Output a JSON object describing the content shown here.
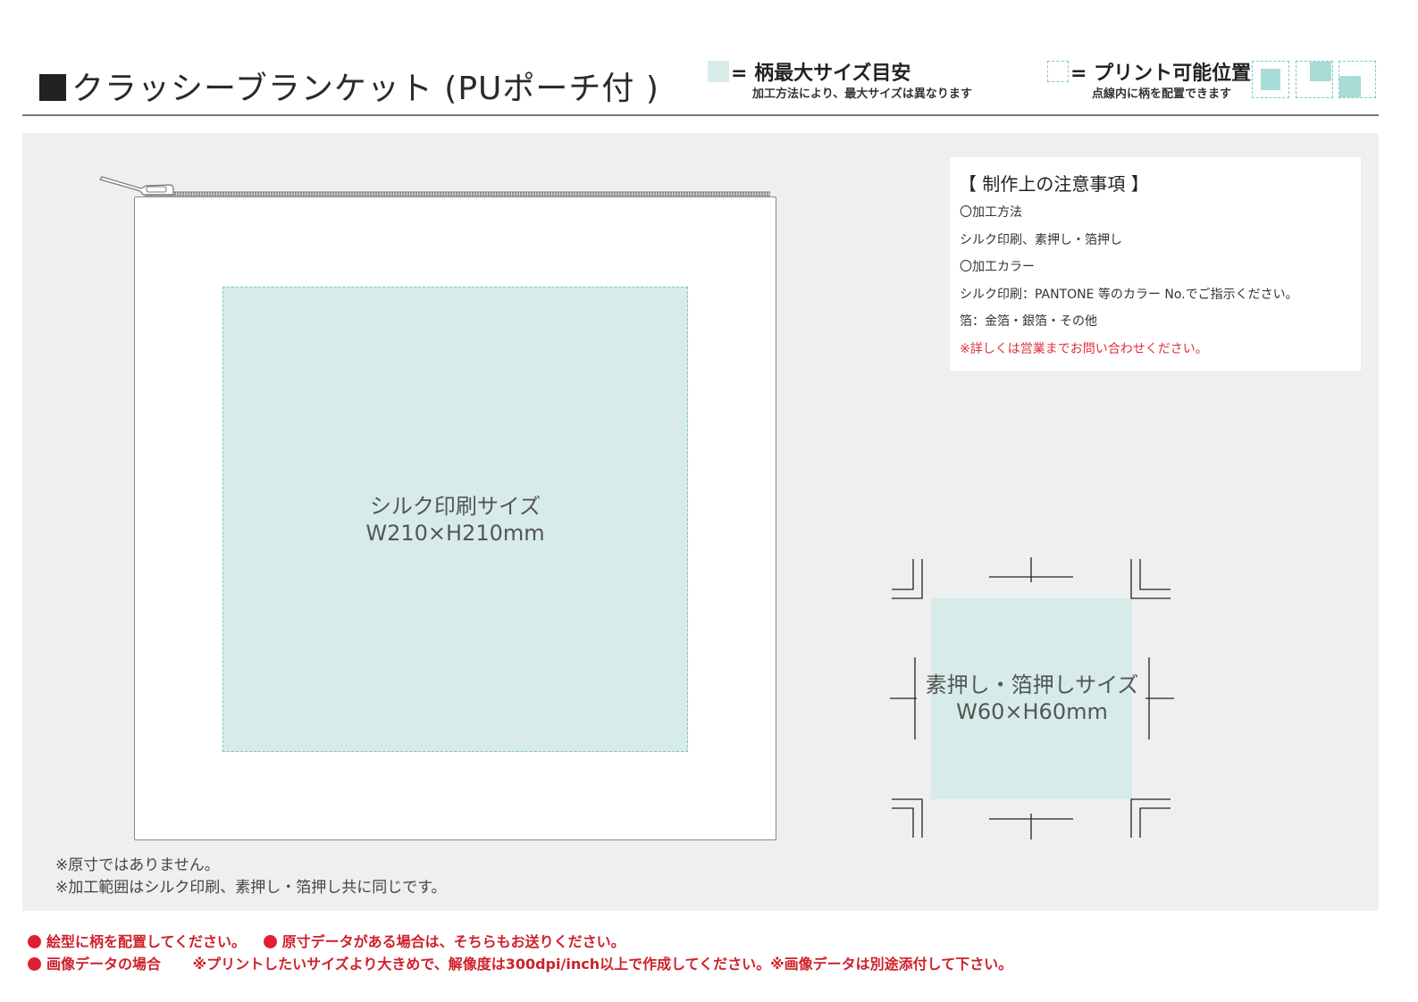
{
  "header": {
    "title": "クラッシーブランケット (PUポーチ付 )",
    "legend_max": {
      "label": "= 柄最大サイズ目安",
      "sub": "加工方法により、最大サイズは異なります"
    },
    "legend_print": {
      "label": "= プリント可能位置",
      "sub": "点線内に柄を配置できます"
    }
  },
  "main": {
    "print_area": {
      "name": "シルク印刷サイズ",
      "size": "W210×H210mm"
    },
    "emboss_area": {
      "name": "素押し・箔押しサイズ",
      "size": "W60×H60mm"
    },
    "disclaimer": [
      "※原寸ではありません。",
      "※加工範囲はシルク印刷、素押し・箔押し共に同じです。"
    ]
  },
  "notes": {
    "title": "【 制作上の注意事項 】",
    "lines": [
      "〇加工方法",
      "シルク印刷、素押し・箔押し",
      "〇加工カラー",
      "シルク印刷：PANTONE 等のカラー No.でご指示ください。",
      "箔：金箔・銀箔・その他"
    ],
    "warning": "※詳しくは営業までお問い合わせください。"
  },
  "footer": {
    "line1_a": "絵型に柄を配置してください。",
    "line1_b": "原寸データがある場合は、そちらもお送りください。",
    "line2_a": "画像データの場合",
    "line2_b": "※プリントしたいサイズより大きめで、解像度は300dpi/inch以上で作成してください。※画像データは別途添付して下さい。"
  },
  "colors": {
    "area_fill": "#d7ece9",
    "dash": "#7fc8c4",
    "warning_red": "#e0303a"
  }
}
